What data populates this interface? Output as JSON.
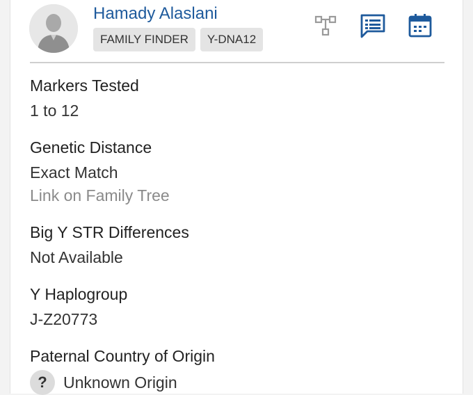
{
  "profile": {
    "name": "Hamady Alaslani",
    "tags": [
      "FAMILY FINDER",
      "Y-DNA12"
    ],
    "avatar_icon": "default-user-avatar-icon"
  },
  "actions": {
    "tree_icon": "family-tree-icon",
    "message_icon": "message-icon",
    "calendar_icon": "calendar-icon",
    "active_color": "#1e5a9c",
    "inactive_color": "#9a9a9a"
  },
  "fields": {
    "markers": {
      "label": "Markers Tested",
      "value": "1 to 12"
    },
    "distance": {
      "label": "Genetic Distance",
      "value": "Exact Match",
      "link": "Link on Family Tree"
    },
    "bigy": {
      "label": "Big Y STR Differences",
      "value": "Not Available"
    },
    "haplogroup": {
      "label": "Y Haplogroup",
      "value": "J-Z20773"
    },
    "origin": {
      "label": "Paternal Country of Origin",
      "value": "Unknown Origin",
      "icon_glyph": "?"
    }
  }
}
